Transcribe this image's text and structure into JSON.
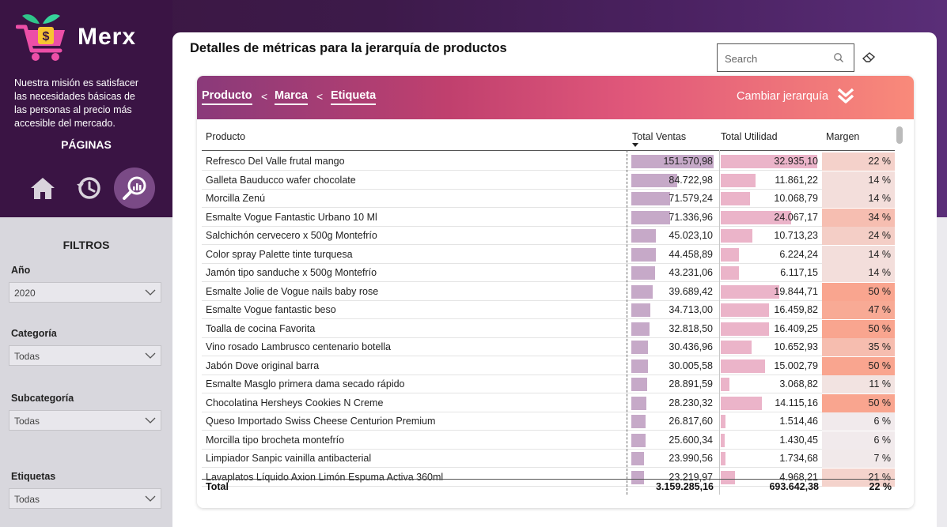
{
  "brand": {
    "name": "Merx",
    "mission": "Nuestra misión es satisfacer las necesidades básicas de las personas al precio más accesible del mercado."
  },
  "nav": {
    "title": "PÁGINAS",
    "icons": [
      "home-icon",
      "history-icon",
      "search-chart-icon"
    ]
  },
  "filters": {
    "title": "FILTROS",
    "items": [
      {
        "label": "Año",
        "value": "2020"
      },
      {
        "label": "Categoría",
        "value": "Todas"
      },
      {
        "label": "Subcategoría",
        "value": "Todas"
      },
      {
        "label": "Etiquetas",
        "value": "Todas"
      }
    ]
  },
  "main": {
    "title": "Detalles de métricas para la jerarquía de productos",
    "search_placeholder": "Search",
    "breadcrumb": [
      "Producto",
      "Marca",
      "Etiqueta"
    ],
    "separator": "<",
    "change_hierarchy": "Cambiar jerarquía"
  },
  "table": {
    "columns": [
      "Producto",
      "Total Ventas",
      "Total Utilidad",
      "Margen"
    ],
    "rows": [
      {
        "product": "Refresco Del Valle frutal mango",
        "sales": "151.570,98",
        "sales_v": 151570.98,
        "profit": "32.935,10",
        "profit_v": 32935.1,
        "margin": "22 %",
        "margin_v": 22
      },
      {
        "product": "Galleta Bauducco wafer chocolate",
        "sales": "84.722,98",
        "sales_v": 84722.98,
        "profit": "11.861,22",
        "profit_v": 11861.22,
        "margin": "14 %",
        "margin_v": 14
      },
      {
        "product": "Morcilla Zenú",
        "sales": "71.579,24",
        "sales_v": 71579.24,
        "profit": "10.068,79",
        "profit_v": 10068.79,
        "margin": "14 %",
        "margin_v": 14
      },
      {
        "product": "Esmalte Vogue Fantastic Urbano 10 Ml",
        "sales": "71.336,96",
        "sales_v": 71336.96,
        "profit": "24.067,17",
        "profit_v": 24067.17,
        "margin": "34 %",
        "margin_v": 34
      },
      {
        "product": "Salchichón cervecero x 500g Montefrío",
        "sales": "45.023,10",
        "sales_v": 45023.1,
        "profit": "10.713,23",
        "profit_v": 10713.23,
        "margin": "24 %",
        "margin_v": 24
      },
      {
        "product": "Color spray Palette tinte turquesa",
        "sales": "44.458,89",
        "sales_v": 44458.89,
        "profit": "6.224,24",
        "profit_v": 6224.24,
        "margin": "14 %",
        "margin_v": 14
      },
      {
        "product": "Jamón tipo sanduche x 500g Montefrío",
        "sales": "43.231,06",
        "sales_v": 43231.06,
        "profit": "6.117,15",
        "profit_v": 6117.15,
        "margin": "14 %",
        "margin_v": 14
      },
      {
        "product": "Esmalte Jolie de Vogue nails baby rose",
        "sales": "39.689,42",
        "sales_v": 39689.42,
        "profit": "19.844,71",
        "profit_v": 19844.71,
        "margin": "50 %",
        "margin_v": 50
      },
      {
        "product": "Esmalte Vogue fantastic beso",
        "sales": "34.713,00",
        "sales_v": 34713.0,
        "profit": "16.459,82",
        "profit_v": 16459.82,
        "margin": "47 %",
        "margin_v": 47
      },
      {
        "product": "Toalla de cocina Favorita",
        "sales": "32.818,50",
        "sales_v": 32818.5,
        "profit": "16.409,25",
        "profit_v": 16409.25,
        "margin": "50 %",
        "margin_v": 50
      },
      {
        "product": "Vino rosado Lambrusco centenario botella",
        "sales": "30.436,96",
        "sales_v": 30436.96,
        "profit": "10.652,93",
        "profit_v": 10652.93,
        "margin": "35 %",
        "margin_v": 35
      },
      {
        "product": "Jabón Dove original barra",
        "sales": "30.005,58",
        "sales_v": 30005.58,
        "profit": "15.002,79",
        "profit_v": 15002.79,
        "margin": "50 %",
        "margin_v": 50
      },
      {
        "product": "Esmalte Masglo primera dama secado rápido",
        "sales": "28.891,59",
        "sales_v": 28891.59,
        "profit": "3.068,82",
        "profit_v": 3068.82,
        "margin": "11 %",
        "margin_v": 11
      },
      {
        "product": "Chocolatina Hersheys Cookies N Creme",
        "sales": "28.230,32",
        "sales_v": 28230.32,
        "profit": "14.115,16",
        "profit_v": 14115.16,
        "margin": "50 %",
        "margin_v": 50
      },
      {
        "product": "Queso Importado Swiss Cheese Centurion Premium",
        "sales": "26.817,60",
        "sales_v": 26817.6,
        "profit": "1.514,46",
        "profit_v": 1514.46,
        "margin": "6 %",
        "margin_v": 6
      },
      {
        "product": "Morcilla tipo brocheta montefrío",
        "sales": "25.600,34",
        "sales_v": 25600.34,
        "profit": "1.430,45",
        "profit_v": 1430.45,
        "margin": "6 %",
        "margin_v": 6
      },
      {
        "product": "Limpiador Sanpic vainilla antibacterial",
        "sales": "23.990,56",
        "sales_v": 23990.56,
        "profit": "1.734,68",
        "profit_v": 1734.68,
        "margin": "7 %",
        "margin_v": 7
      },
      {
        "product": "Lavaplatos Líquido Axion Limón Espuma Activa 360ml",
        "sales": "23.219,97",
        "sales_v": 23219.97,
        "profit": "4.968,21",
        "profit_v": 4968.21,
        "margin": "21 %",
        "margin_v": 21
      }
    ],
    "total": {
      "label": "Total",
      "sales": "3.159.285,16",
      "profit": "693.642,38",
      "margin": "22 %"
    }
  },
  "colors": {
    "sales_bar": "#c6a9c8",
    "profit_bar": "#ebb4c9",
    "margin_high": "#f9a58f",
    "margin_low": "#f1ecee"
  }
}
